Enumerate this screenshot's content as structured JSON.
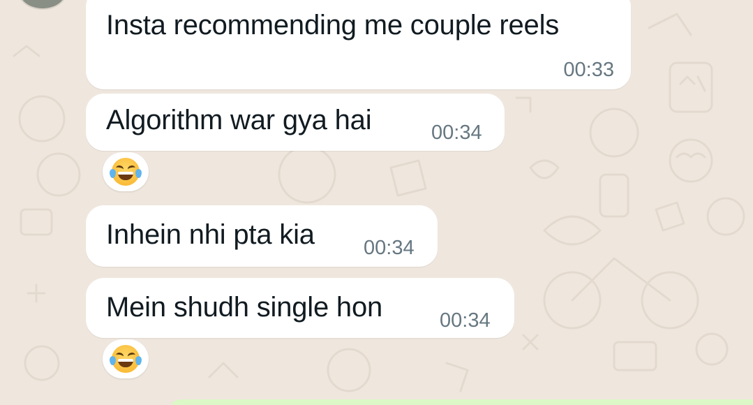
{
  "messages": [
    {
      "text": "Insta recommending me couple reels",
      "time": "00:33"
    },
    {
      "text": "Algorithm war gya hai",
      "time": "00:34",
      "reaction": "face-with-tears-of-joy"
    },
    {
      "text": "Inhein nhi pta kia",
      "time": "00:34"
    },
    {
      "text": "Mein shudh single hon",
      "time": "00:34",
      "reaction": "face-with-tears-of-joy"
    }
  ],
  "colors": {
    "background": "#efe7de",
    "incoming_bubble": "#ffffff",
    "outgoing_bubble": "#dcf8c6",
    "text": "#111b21",
    "timestamp": "#667781"
  }
}
